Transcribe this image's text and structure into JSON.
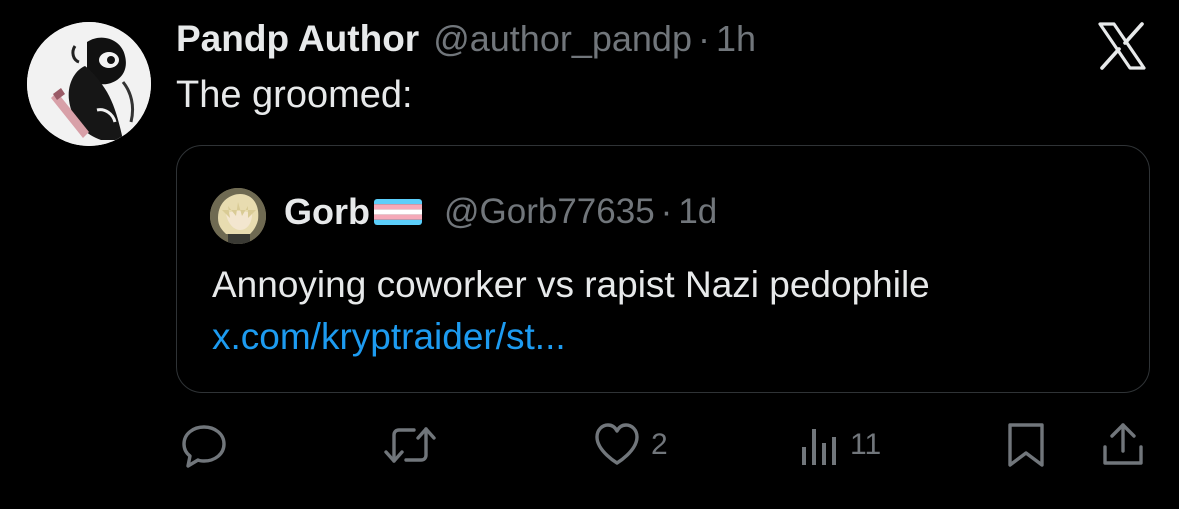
{
  "tweet": {
    "author_name": "Pandp Author",
    "author_handle": "@author_pandp",
    "separator": "·",
    "time": "1h",
    "text": "The groomed:",
    "avatar_icon": "panda-avatar-icon",
    "platform_logo": "x-logo-icon"
  },
  "quoted_tweet": {
    "author_name": "Gorb",
    "flag_icon": "transgender-flag-icon",
    "author_handle": "@Gorb77635",
    "separator": "·",
    "time": "1d",
    "text": "Annoying coworker vs rapist Nazi pedophile",
    "link_text": "x.com/kryptraider/st..."
  },
  "actions": {
    "reply_icon": "reply-icon",
    "retweet_icon": "retweet-icon",
    "like_icon": "heart-icon",
    "like_count": "2",
    "views_icon": "views-icon",
    "view_count": "11",
    "bookmark_icon": "bookmark-icon",
    "share_icon": "share-icon"
  },
  "colors": {
    "background": "#000000",
    "primary_text": "#e7e9ea",
    "secondary_text": "#71767b",
    "link": "#1d9bf0",
    "border": "#2f3336",
    "flag_blue": "#5bcefa",
    "flag_pink": "#f5a9b8",
    "flag_white": "#ffffff"
  }
}
